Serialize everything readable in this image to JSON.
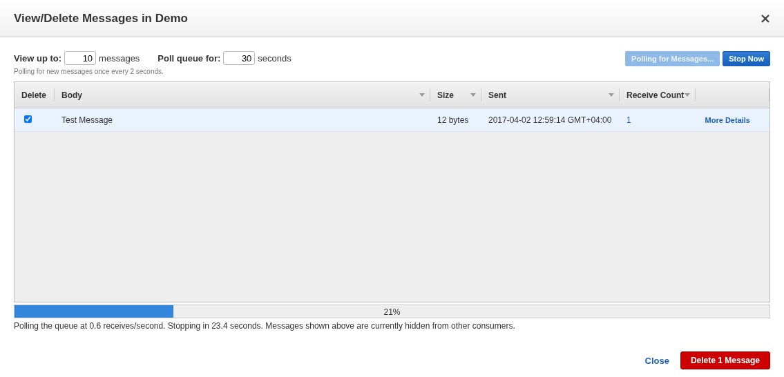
{
  "window": {
    "title": "View/Delete Messages in Demo"
  },
  "options": {
    "view_label": "View up to:",
    "view_value": "10",
    "view_unit": "messages",
    "poll_label": "Poll queue for:",
    "poll_value": "30",
    "poll_unit": "seconds",
    "hint": "Polling for new messages once every 2 seconds."
  },
  "top_buttons": [
    {
      "label": "Polling for Messages...",
      "disabled": true
    },
    {
      "label": "Stop Now",
      "disabled": false
    }
  ],
  "table": {
    "columns": [
      {
        "label": "Delete",
        "sortable": false
      },
      {
        "label": "Body",
        "sortable": true
      },
      {
        "label": "Size",
        "sortable": true
      },
      {
        "label": "Sent",
        "sortable": true
      },
      {
        "label": "Receive Count",
        "sortable": true
      }
    ],
    "rows": [
      {
        "checked": true,
        "selected": true,
        "body": "Test Message",
        "size": "12 bytes",
        "sent": "2017-04-02 12:59:14 GMT+04:00",
        "receive_count": "1",
        "link": "More Details"
      }
    ]
  },
  "progress": {
    "level": 0.21,
    "label": "21%"
  },
  "status": "Polling the queue at 0.6 receives/second. Stopping in 23.4 seconds. Messages shown above are currently hidden from other consumers.",
  "footer": {
    "close": "Close",
    "primary": "Delete 1 Message"
  }
}
